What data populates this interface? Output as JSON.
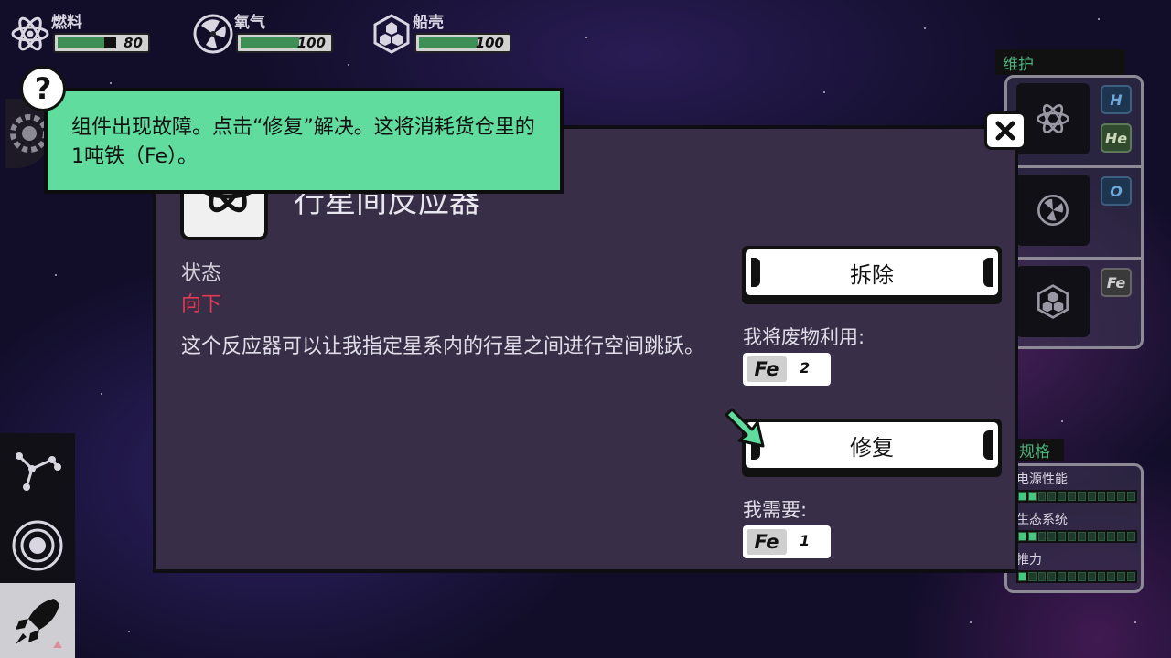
{
  "hud": {
    "stats": [
      {
        "label": "燃料",
        "value": "80",
        "level": 0.8,
        "icon": "atom-icon"
      },
      {
        "label": "氧气",
        "value": "100",
        "level": 1.0,
        "icon": "fan-icon"
      },
      {
        "label": "船壳",
        "value": "100",
        "level": 1.0,
        "icon": "hexagon-hull-icon"
      }
    ]
  },
  "tutorial": {
    "help_symbol": "?",
    "text": "组件出现故障。点击“修复”解决。这将消耗货仓里的1吨铁（Fe）。"
  },
  "dialog": {
    "title": "行星间反应器",
    "status_label": "状态",
    "status_value": "向下",
    "description": "这个反应器可以让我指定星系内的行星之间进行空间跳跃。",
    "dismantle_label": "拆除",
    "salvage_label": "我将废物利用:",
    "salvage": {
      "symbol": "Fe",
      "count": "2"
    },
    "repair_label": "修复",
    "requirement_label": "我需要:",
    "requirement": {
      "symbol": "Fe",
      "count": "1"
    },
    "close_symbol": "✕"
  },
  "maintenance": {
    "title": "维护",
    "rows": [
      {
        "icon": "atom-icon",
        "elements": [
          "H",
          "He"
        ]
      },
      {
        "icon": "fan-icon",
        "elements": [
          "O"
        ]
      },
      {
        "icon": "hexagon-hull-icon",
        "elements": [
          "Fe"
        ]
      }
    ]
  },
  "specs": {
    "title": "规格",
    "items": [
      {
        "label": "电源性能",
        "level": 2,
        "max": 12
      },
      {
        "label": "生态系统",
        "level": 2,
        "max": 12
      },
      {
        "label": "推力",
        "level": 1,
        "max": 12
      }
    ]
  },
  "colors": {
    "accent_green": "#5fdc9e",
    "status_red": "#e03a55",
    "dialog_bg": "#392e47",
    "bar_green": "#3e8f55"
  }
}
